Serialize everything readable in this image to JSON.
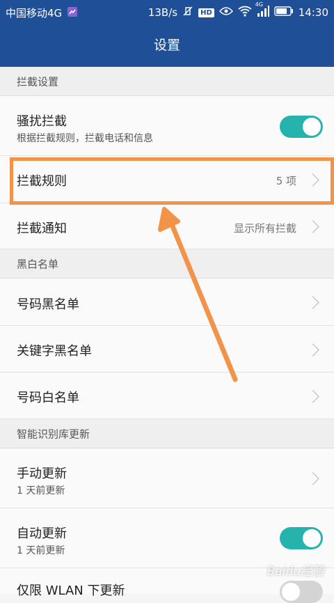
{
  "status_bar": {
    "carrier": "中国移动4G",
    "speed": "13B/s",
    "hd": "HD",
    "network": "4G",
    "time": "14:30"
  },
  "app_bar": {
    "title": "设置"
  },
  "sections": {
    "intercept": "拦截设置",
    "blackwhite": "黑白名单",
    "smartlib": "智能识别库更新"
  },
  "rows": {
    "harass": {
      "title": "骚扰拦截",
      "subtitle": "根据拦截规则，拦截电话和信息",
      "toggle_on": true
    },
    "rules": {
      "title": "拦截规则",
      "value": "5 项"
    },
    "notify": {
      "title": "拦截通知",
      "value": "显示所有拦截"
    },
    "number_black": {
      "title": "号码黑名单"
    },
    "keyword_black": {
      "title": "关键字黑名单"
    },
    "number_white": {
      "title": "号码白名单"
    },
    "manual_update": {
      "title": "手动更新",
      "subtitle": "1 天前更新"
    },
    "auto_update": {
      "title": "自动更新",
      "subtitle": "1 天前更新",
      "toggle_on": true
    },
    "wlan_only": {
      "title": "仅限 WLAN 下更新",
      "toggle_on": false
    }
  },
  "watermark": "Baidu经验",
  "colors": {
    "header": "#1f4f96",
    "toggle_on": "#26b3ad",
    "highlight": "#f3934a"
  }
}
